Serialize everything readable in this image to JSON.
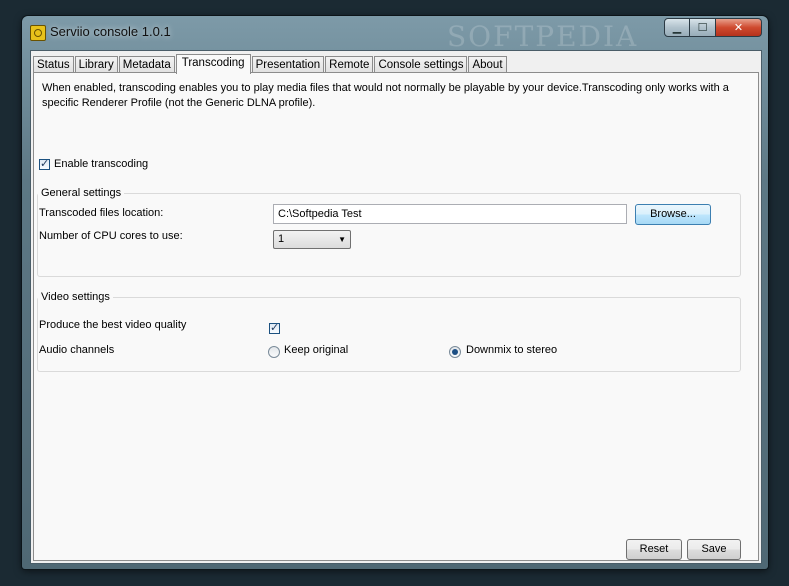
{
  "window": {
    "title": "Serviio console 1.0.1",
    "watermark": "SOFTPEDIA",
    "icon": "serviio-app-icon",
    "caption_buttons": {
      "minimize": "▁",
      "maximize": "☐",
      "close": "✕"
    }
  },
  "tabs": [
    {
      "label": "Status",
      "active": false
    },
    {
      "label": "Library",
      "active": false
    },
    {
      "label": "Metadata",
      "active": false
    },
    {
      "label": "Transcoding",
      "active": true
    },
    {
      "label": "Presentation",
      "active": false
    },
    {
      "label": "Remote",
      "active": false
    },
    {
      "label": "Console settings",
      "active": false
    },
    {
      "label": "About",
      "active": false
    }
  ],
  "transcoding": {
    "description": "When enabled, transcoding enables you to play media files that would not normally be playable by your device.Transcoding only works with a specific Renderer Profile (not the Generic DLNA profile).",
    "enable_label": "Enable transcoding",
    "enable_checked": true,
    "general": {
      "title": "General settings",
      "location_label": "Transcoded files location:",
      "location_value": "C:\\Softpedia Test",
      "browse_label": "Browse...",
      "cpu_label": "Number of CPU cores to use:",
      "cpu_value": "1"
    },
    "video": {
      "title": "Video settings",
      "quality_label": "Produce the best video quality",
      "quality_checked": true,
      "audio_label": "Audio channels",
      "audio_options": [
        "Keep original",
        "Downmix to stereo"
      ],
      "audio_selected": "Downmix to stereo"
    }
  },
  "footer": {
    "reset_label": "Reset",
    "save_label": "Save"
  },
  "colors": {
    "window_frame": "#5d7885",
    "panel_background": "#f9f9f9",
    "focus_button": "#bee6fd",
    "close_button": "#cf4a2f"
  }
}
